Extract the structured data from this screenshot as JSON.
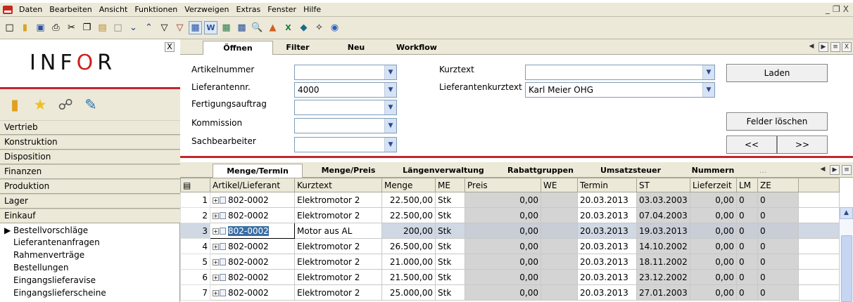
{
  "menu": [
    "Daten",
    "Bearbeiten",
    "Ansicht",
    "Funktionen",
    "Verzweigen",
    "Extras",
    "Fenster",
    "Hilfe"
  ],
  "window_controls": [
    "_",
    "❐",
    "X"
  ],
  "toolbar_icons": [
    "new-doc-icon",
    "open-folder-icon",
    "save-icon",
    "print-icon",
    "cut-icon",
    "copy-icon",
    "paste-icon",
    "blank-icon",
    "chevron-down-icon",
    "chevron-up-icon",
    "filter-icon",
    "filter-clear-icon",
    "table-view-icon",
    "word-icon",
    "grid-icon",
    "calculator-icon",
    "search-icon",
    "chart-icon",
    "excel-icon",
    "diamond-icon",
    "sip-icon",
    "help-icon"
  ],
  "logo": "INFOR",
  "left_close": "X",
  "nav_groups": [
    "Vertrieb",
    "Konstruktion",
    "Disposition",
    "Finanzen",
    "Produktion",
    "Lager",
    "Einkauf"
  ],
  "einkauf_items": [
    "▶ Bestellvorschläge",
    "Lieferantenanfragen",
    "Rahmenverträge",
    "Bestellungen",
    "Eingangslieferavise",
    "Eingangslieferscheine"
  ],
  "top_tabs": [
    "Öffnen",
    "Filter",
    "Neu",
    "Workflow"
  ],
  "form": {
    "artikelnummer_label": "Artikelnummer",
    "lieferantennr_label": "Lieferantennr.",
    "lieferantennr_value": "4000",
    "fertigungsauftrag_label": "Fertigungsauftrag",
    "kommission_label": "Kommission",
    "sachbearbeiter_label": "Sachbearbeiter",
    "kurztext_label": "Kurztext",
    "lieferantenkurztext_label": "Lieferantenkurztext",
    "lieferantenkurztext_value": "Karl Meier OHG",
    "laden_btn": "Laden",
    "felder_btn": "Felder löschen",
    "prev_btn": "<<",
    "next_btn": ">>"
  },
  "bottom_tabs": [
    "Menge/Termin",
    "Menge/Preis",
    "Längenverwaltung",
    "Rabattgruppen",
    "Umsatzsteuer",
    "Nummern",
    "..."
  ],
  "grid": {
    "columns": [
      "Artikel/Lieferant",
      "Kurztext",
      "Menge",
      "ME",
      "Preis",
      "WE",
      "Termin",
      "ST",
      "Lieferzeit",
      "LM",
      "ZE"
    ],
    "rows": [
      {
        "n": "1",
        "art": "802-0002",
        "kurz": "Elektromotor 2",
        "menge": "22.500,00",
        "me": "Stk",
        "preis": "0,00",
        "we": "",
        "termin": "20.03.2013",
        "st": "03.03.2003",
        "lz": "0,00",
        "lm": "0",
        "ze": "0"
      },
      {
        "n": "2",
        "art": "802-0002",
        "kurz": "Elektromotor 2",
        "menge": "22.500,00",
        "me": "Stk",
        "preis": "0,00",
        "we": "",
        "termin": "20.03.2013",
        "st": "07.04.2003",
        "lz": "0,00",
        "lm": "0",
        "ze": "0"
      },
      {
        "n": "3",
        "art": "802-0002",
        "kurz": "Motor aus AL",
        "menge": "200,00",
        "me": "Stk",
        "preis": "0,00",
        "we": "",
        "termin": "20.03.2013",
        "st": "19.03.2013",
        "lz": "0,00",
        "lm": "0",
        "ze": "0"
      },
      {
        "n": "4",
        "art": "802-0002",
        "kurz": "Elektromotor 2",
        "menge": "26.500,00",
        "me": "Stk",
        "preis": "0,00",
        "we": "",
        "termin": "20.03.2013",
        "st": "14.10.2002",
        "lz": "0,00",
        "lm": "0",
        "ze": "0"
      },
      {
        "n": "5",
        "art": "802-0002",
        "kurz": "Elektromotor 2",
        "menge": "21.000,00",
        "me": "Stk",
        "preis": "0,00",
        "we": "",
        "termin": "20.03.2013",
        "st": "18.11.2002",
        "lz": "0,00",
        "lm": "0",
        "ze": "0"
      },
      {
        "n": "6",
        "art": "802-0002",
        "kurz": "Elektromotor 2",
        "menge": "21.500,00",
        "me": "Stk",
        "preis": "0,00",
        "we": "",
        "termin": "20.03.2013",
        "st": "23.12.2002",
        "lz": "0,00",
        "lm": "0",
        "ze": "0"
      },
      {
        "n": "7",
        "art": "802-0002",
        "kurz": "Elektromotor 2",
        "menge": "25.000,00",
        "me": "Stk",
        "preis": "0,00",
        "we": "",
        "termin": "20.03.2013",
        "st": "27.01.2003",
        "lz": "0,00",
        "lm": "0",
        "ze": "0"
      }
    ]
  },
  "colors": {
    "accent_red": "#c2272d",
    "panel_bg": "#ece9d8",
    "selection": "#3a6ea5"
  }
}
